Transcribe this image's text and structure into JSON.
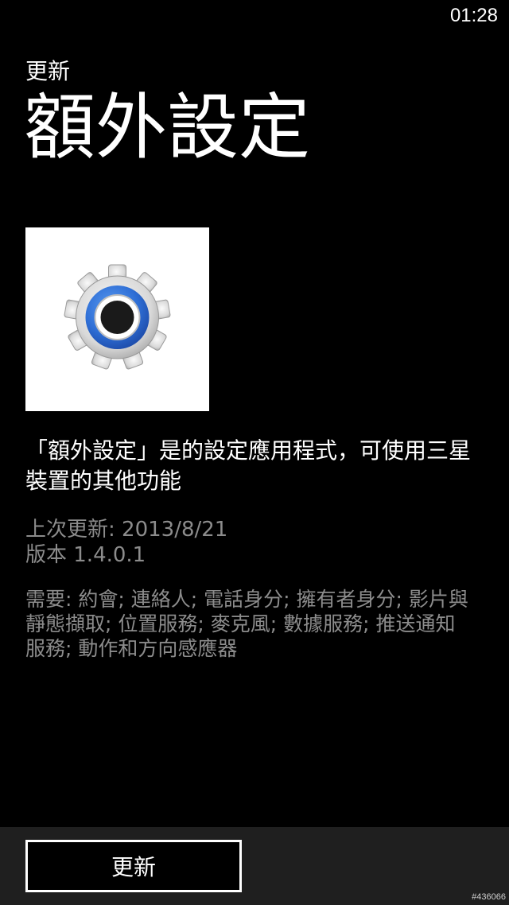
{
  "status_bar": {
    "time": "01:28"
  },
  "header": {
    "app_name": "更新",
    "title": "額外設定"
  },
  "app": {
    "icon": "settings-gear-icon",
    "description": "「額外設定」是的設定應用程式，可使用三星裝置的其他功能",
    "last_updated": "上次更新: 2013/8/21",
    "version": "版本 1.4.0.1",
    "requirements": "需要: 約會; 連絡人; 電話身分; 擁有者身分; 影片與靜態擷取; 位置服務; 麥克風; 數據服務; 推送通知服務; 動作和方向感應器"
  },
  "app_bar": {
    "update_label": "更新"
  },
  "watermark": "#436066",
  "colors": {
    "background": "#000000",
    "text_primary": "#ffffff",
    "text_secondary": "#8c8c8c",
    "app_bar": "#1f1f1f",
    "icon_accent": "#2f6fd6"
  }
}
